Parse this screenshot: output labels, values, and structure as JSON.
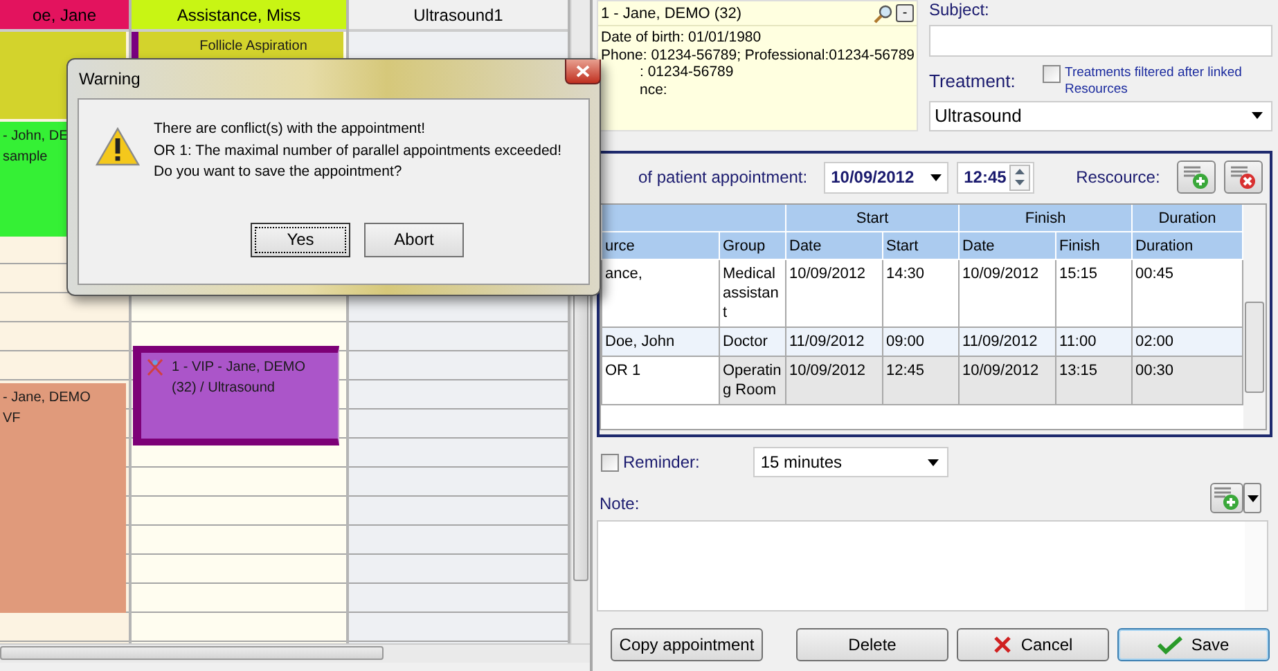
{
  "calendar": {
    "columns": [
      {
        "name": "oe, Jane",
        "color": "#e3135e",
        "appointments": [
          {
            "kind": "plain",
            "color": "#d3d32c"
          },
          {
            "kind": "plain",
            "color": "#35f035",
            "lines": [
              "- John, DE",
              "sample"
            ]
          },
          {
            "kind": "plain",
            "color": "#e09a7b",
            "lines": [
              "- Jane, DEMO",
              "VF"
            ]
          }
        ]
      },
      {
        "name": "Assistance, Miss",
        "color": "#c8f514",
        "appointments": [
          {
            "kind": "striped",
            "color": "#d3d32c",
            "lines": [
              "Follicle Aspiration"
            ]
          },
          {
            "kind": "framed",
            "color": "#ab55c9",
            "lines": [
              "1 - VIP - Jane, DEMO",
              "(32) / Ultrasound"
            ]
          }
        ]
      },
      {
        "name": "Ultrasound1",
        "color": "#f0f0f0"
      }
    ]
  },
  "dialog": {
    "title": "Warning",
    "lines": [
      "There are conflict(s) with the appointment!",
      "OR 1: The maximal number of parallel appointments exceeded!",
      "Do you want to save the appointment?"
    ],
    "buttons": [
      {
        "label": "Yes",
        "selected": true
      },
      {
        "label": "Abort",
        "selected": false
      }
    ]
  },
  "patient": {
    "name": "1 - Jane, DEMO (32)",
    "collapse": "-",
    "details": [
      "Date of birth: 01/01/1980",
      "Phone: 01234-56789; Professional:01234-56789",
      ": 01234-56789",
      "nce:"
    ]
  },
  "subject": {
    "label": "Subject:"
  },
  "treatment": {
    "label": "Treatment:",
    "filter": {
      "label": "Treatments filtered after linked Resources",
      "checked": false
    },
    "value": "Ultrasound"
  },
  "appointment": {
    "label": "of patient appointment:",
    "date": "10/09/2012",
    "time": "12:45",
    "resource_label": "Rescource:"
  },
  "table": {
    "groups": [
      "Start",
      "Finish",
      "Duration"
    ],
    "columns": [
      "urce",
      "Group",
      "Date",
      "Start",
      "Date",
      "Finish",
      "Duration"
    ],
    "rows": [
      {
        "selected": false,
        "conflict": false,
        "cells": [
          "ance,",
          "Medical assistant",
          "10/09/2012",
          "14:30",
          "10/09/2012",
          "15:15",
          "00:45"
        ]
      },
      {
        "selected": true,
        "conflict": false,
        "cells": [
          "Doe, John",
          "Doctor",
          "11/09/2012",
          "09:00",
          "11/09/2012",
          "11:00",
          "02:00"
        ]
      },
      {
        "selected": false,
        "conflict": true,
        "cells": [
          "OR 1",
          "Operating Room",
          "10/09/2012",
          "12:45",
          "10/09/2012",
          "13:15",
          "00:30"
        ]
      }
    ]
  },
  "reminder": {
    "label": "Reminder:",
    "checked": false,
    "value": "15 minutes"
  },
  "note": {
    "label": "Note:"
  },
  "buttons": [
    {
      "label": "Copy appointment",
      "kind": "plain"
    },
    {
      "label": "Delete",
      "kind": "plain"
    },
    {
      "label": "Cancel",
      "kind": "cancel"
    },
    {
      "label": "Save",
      "kind": "save"
    }
  ]
}
